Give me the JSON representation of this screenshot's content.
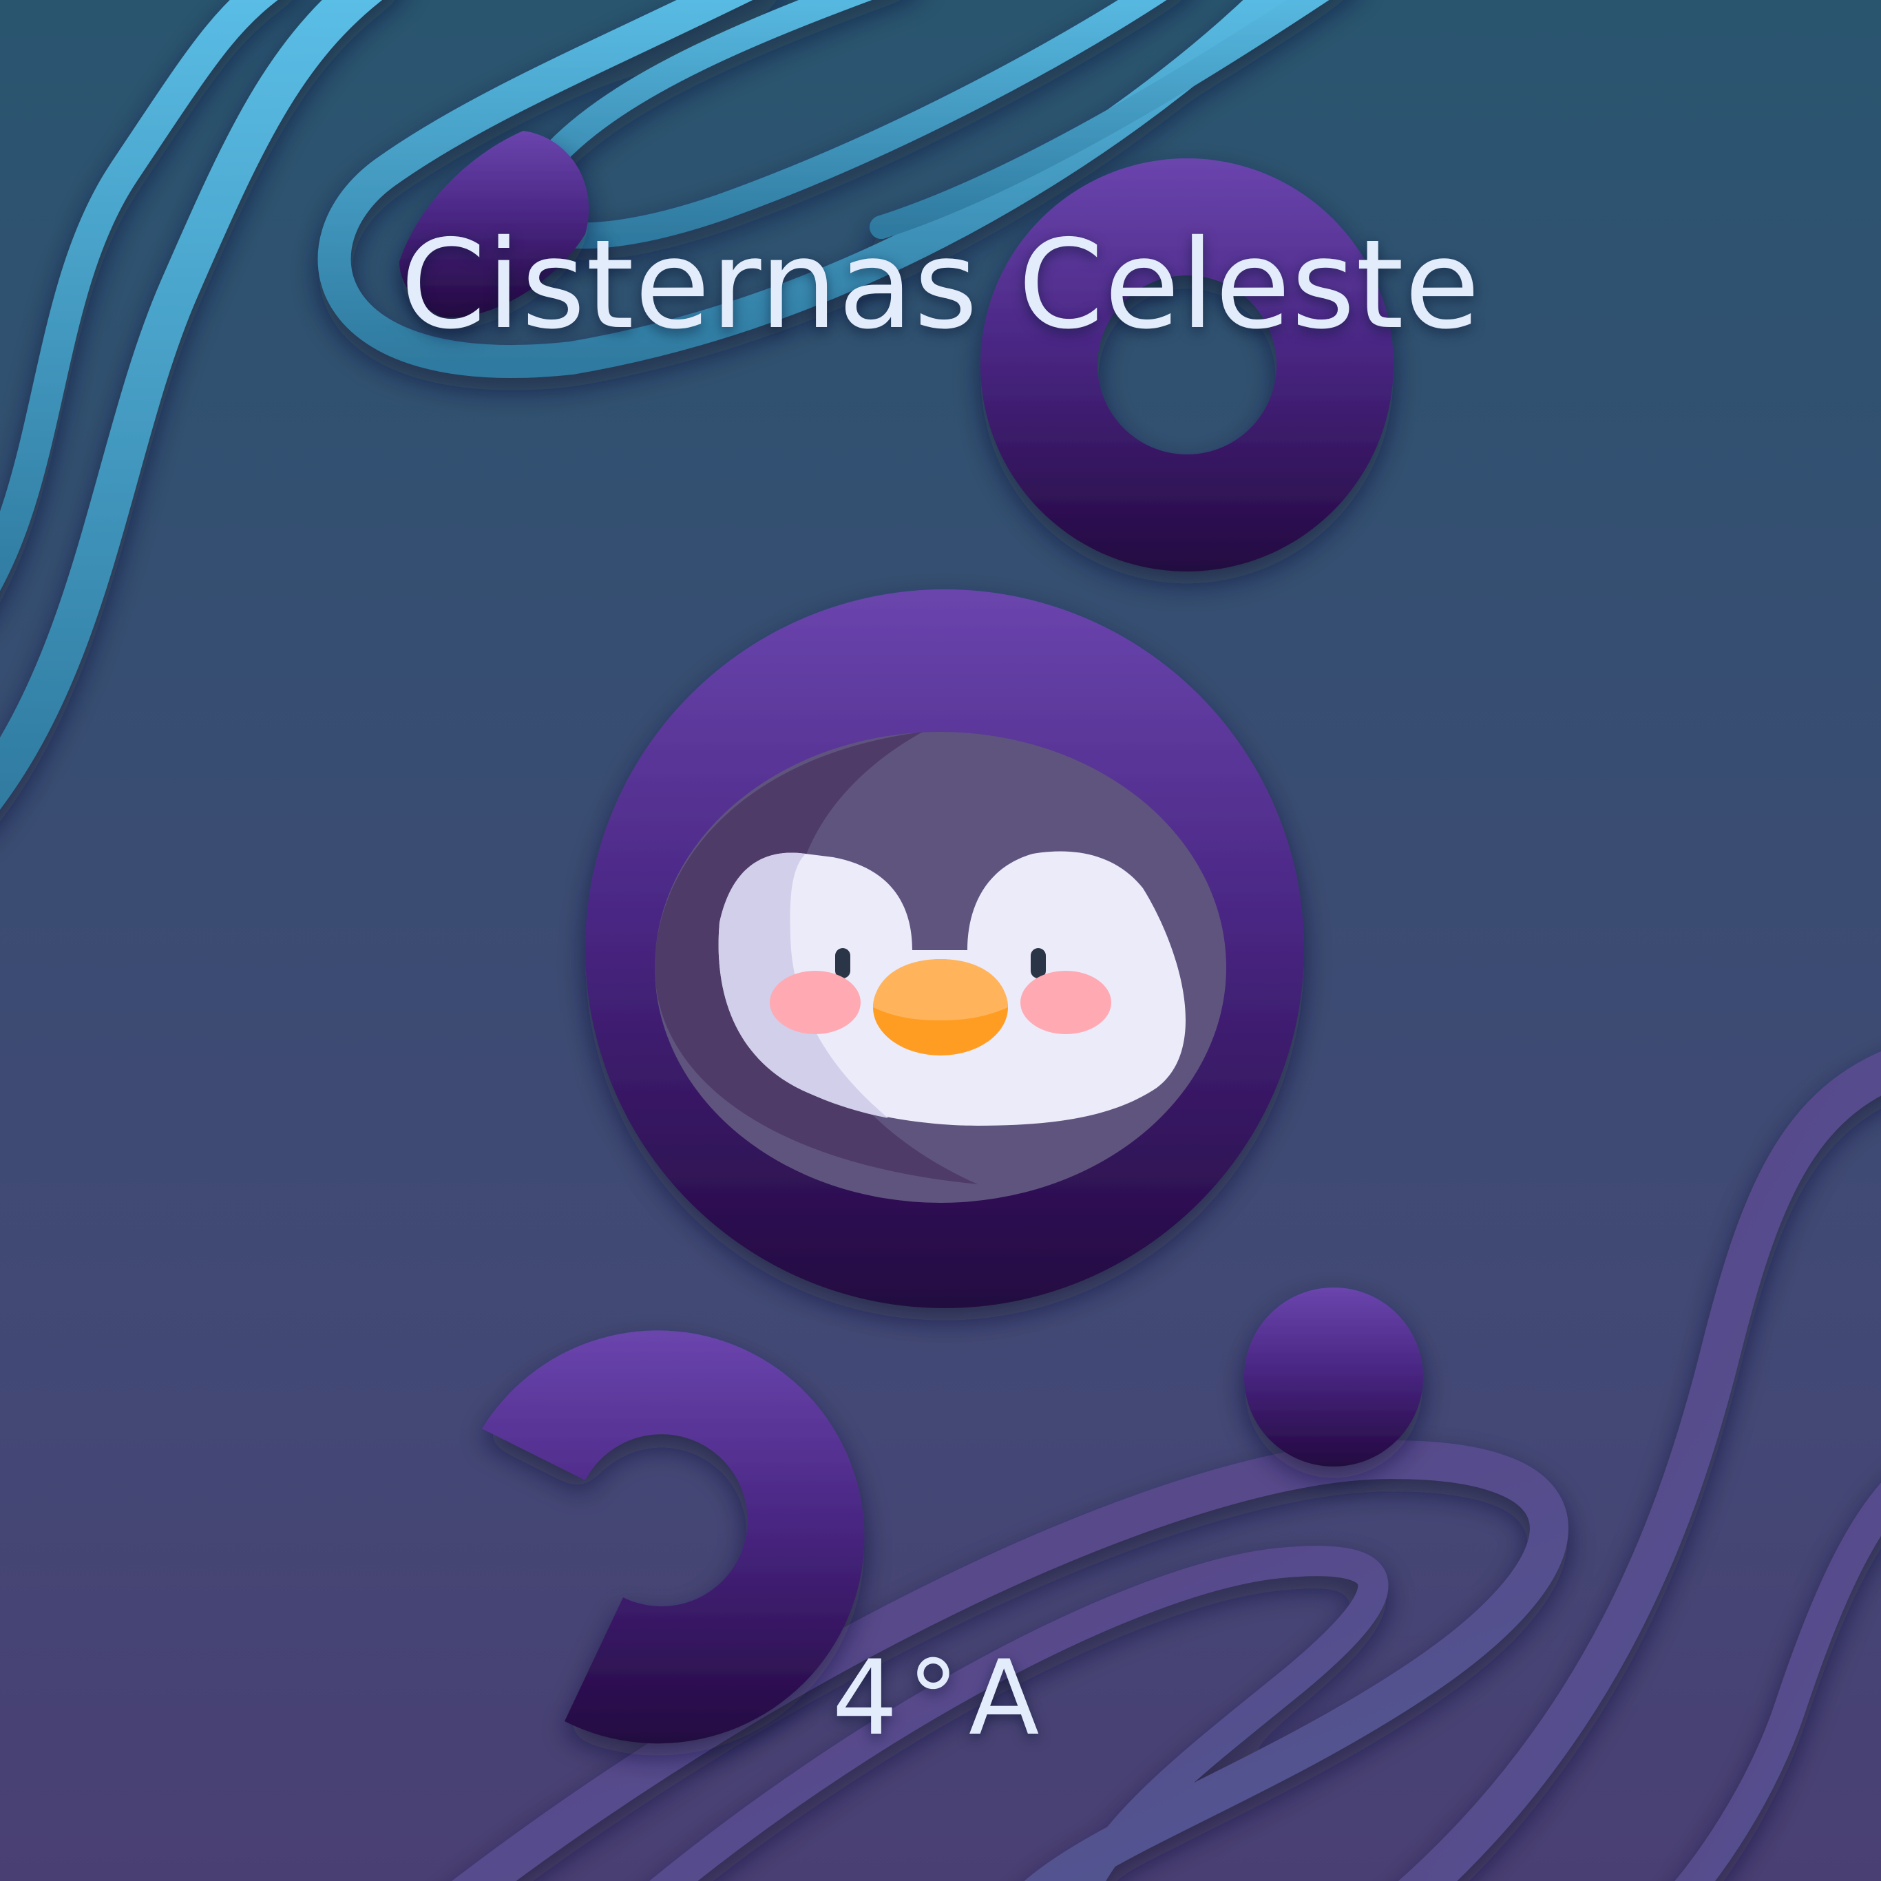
{
  "title": "Cisternas Celeste",
  "subtitle": "4°A",
  "colors": {
    "background_top": "#29556f",
    "background_bottom": "#4a3f73",
    "ribbon_blue": "#4fa8cf",
    "ribbon_purple": "#5e4a8c",
    "shape_purple_light": "#6642a8",
    "shape_purple_dark": "#24093f",
    "text": "#e3ecfa"
  },
  "icons": {
    "avatar": "penguin-icon"
  }
}
